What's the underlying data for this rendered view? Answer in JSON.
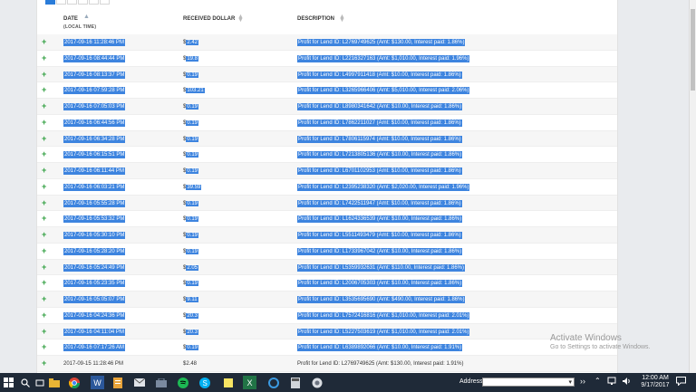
{
  "table": {
    "headers": {
      "date": "DATE",
      "date_sub": "(LOCAL TIME)",
      "amount": "RECEIVED DOLLAR",
      "description": "DESCRIPTION"
    },
    "rows": [
      {
        "date": "2017-09-16 11:28:46 PM",
        "amount": "2.42",
        "desc": "Profit for Lend ID: L2769749625 (Amt: $130.00, Interest paid: 1.86%)",
        "selected": true
      },
      {
        "date": "2017-09-16 08:44:44 PM",
        "amount": "19.8",
        "desc": "Profit for Lend ID: L2216327163 (Amt: $1,010.00, Interest paid: 1.96%)",
        "selected": true
      },
      {
        "date": "2017-09-16 08:13:37 PM",
        "amount": "0.19",
        "desc": "Profit for Lend ID: L4997911418 (Amt: $10.00, Interest paid: 1.86%)",
        "selected": true
      },
      {
        "date": "2017-09-16 07:59:28 PM",
        "amount": "103.21",
        "desc": "Profit for Lend ID: L3265966406 (Amt: $5,010.00, Interest paid: 2.06%)",
        "selected": true
      },
      {
        "date": "2017-09-16 07:05:03 PM",
        "amount": "0.19",
        "desc": "Profit for Lend ID: L8980341642 (Amt: $10.00, Interest paid: 1.86%)",
        "selected": true
      },
      {
        "date": "2017-09-16 06:44:56 PM",
        "amount": "0.19",
        "desc": "Profit for Lend ID: L7862211027 (Amt: $10.00, Interest paid: 1.86%)",
        "selected": true
      },
      {
        "date": "2017-09-16 06:34:28 PM",
        "amount": "0.19",
        "desc": "Profit for Lend ID: L7806115974 (Amt: $10.00, Interest paid: 1.86%)",
        "selected": true
      },
      {
        "date": "2017-09-16 06:15:51 PM",
        "amount": "0.19",
        "desc": "Profit for Lend ID: L7213805136 (Amt: $10.00, Interest paid: 1.86%)",
        "selected": true
      },
      {
        "date": "2017-09-16 06:11:44 PM",
        "amount": "0.19",
        "desc": "Profit for Lend ID: L6701102953 (Amt: $10.00, Interest paid: 1.86%)",
        "selected": true
      },
      {
        "date": "2017-09-16 06:03:21 PM",
        "amount": "39.59",
        "desc": "Profit for Lend ID: L2395238320 (Amt: $2,020.00, Interest paid: 1.96%)",
        "selected": true
      },
      {
        "date": "2017-09-16 05:55:28 PM",
        "amount": "0.19",
        "desc": "Profit for Lend ID: L7422511947 (Amt: $10.00, Interest paid: 1.86%)",
        "selected": true
      },
      {
        "date": "2017-09-16 05:53:32 PM",
        "amount": "0.19",
        "desc": "Profit for Lend ID: L1624336539 (Amt: $10.00, Interest paid: 1.86%)",
        "selected": true
      },
      {
        "date": "2017-09-16 05:30:10 PM",
        "amount": "0.19",
        "desc": "Profit for Lend ID: L5511493479 (Amt: $10.00, Interest paid: 1.86%)",
        "selected": true
      },
      {
        "date": "2017-09-16 05:28:20 PM",
        "amount": "0.19",
        "desc": "Profit for Lend ID: L1733967042 (Amt: $10.00, Interest paid: 1.86%)",
        "selected": true
      },
      {
        "date": "2017-09-16 05:24:49 PM",
        "amount": "2.05",
        "desc": "Profit for Lend ID: L5359932631 (Amt: $110.00, Interest paid: 1.86%)",
        "selected": true
      },
      {
        "date": "2017-09-16 05:23:35 PM",
        "amount": "0.19",
        "desc": "Profit for Lend ID: L2006705303 (Amt: $10.00, Interest paid: 1.86%)",
        "selected": true
      },
      {
        "date": "2017-09-16 05:05:07 PM",
        "amount": "9.11",
        "desc": "Profit for Lend ID: L3535695690 (Amt: $490.00, Interest paid: 1.86%)",
        "selected": true
      },
      {
        "date": "2017-09-16 04:24:36 PM",
        "amount": "20.3",
        "desc": "Profit for Lend ID: L7572416816 (Amt: $1,010.00, Interest paid: 2.01%)",
        "selected": true
      },
      {
        "date": "2017-09-16 04:11:04 PM",
        "amount": "20.3",
        "desc": "Profit for Lend ID: L5227503619 (Amt: $1,010.00, Interest paid: 2.01%)",
        "selected": true
      },
      {
        "date": "2017-09-16 07:17:26 AM",
        "amount": "0.19",
        "desc": "Profit for Lend ID: L6389892066 (Amt: $10.00, Interest paid: 1.91%)",
        "selected": true
      },
      {
        "date": "2017-09-15 11:28:46 PM",
        "amount": "2.48",
        "desc": "Profit for Lend ID: L2769749625 (Amt: $130.00, Interest paid: 1.91%)",
        "selected": false
      }
    ],
    "currency_symbol": "$",
    "plus_symbol": "+"
  },
  "watermark": {
    "title": "Activate Windows",
    "subtitle": "Go to Settings to activate Windows."
  },
  "taskbar": {
    "address_label": "Address",
    "time": "12:00 AM",
    "date": "9/17/2017",
    "icons": [
      "windows-start-icon",
      "search-icon",
      "task-view-icon",
      "file-explorer-icon",
      "chrome-icon",
      "word-icon",
      "document-icon",
      "mail-icon",
      "store-icon",
      "spotify-icon",
      "skype-icon",
      "sticky-notes-icon",
      "excel-icon",
      "edge-icon",
      "calculator-icon",
      "app-icon"
    ]
  },
  "colors": {
    "selection": "#3d84df",
    "plus": "#2e9e3e",
    "taskbar": "#1f2a38"
  }
}
